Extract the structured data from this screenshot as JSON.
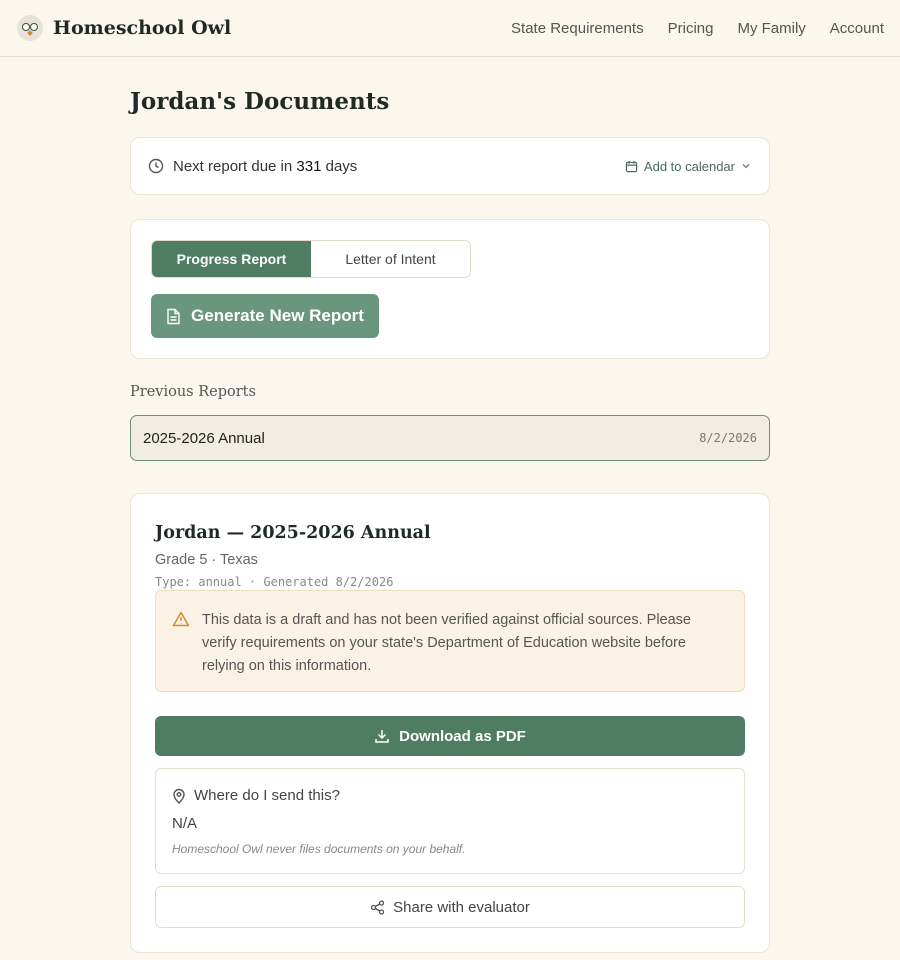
{
  "brand": {
    "name": "Homeschool Owl"
  },
  "nav": [
    "State Requirements",
    "Pricing",
    "My Family",
    "Account"
  ],
  "page": {
    "title": "Jordan's Documents"
  },
  "due": {
    "prefix": "Next report due in",
    "days": "331",
    "suffix": "days",
    "calendar_label": "Add to calendar"
  },
  "generate": {
    "tabs": [
      "Progress Report",
      "Letter of Intent"
    ],
    "active_tab": "Progress Report",
    "button_label": "Generate New Report"
  },
  "previous": {
    "label": "Previous Reports",
    "items": [
      {
        "name": "2025-2026 Annual",
        "date": "8/2/2026"
      }
    ]
  },
  "document": {
    "title": "Jordan — 2025-2026 Annual",
    "subtitle": "Grade 5 · Texas",
    "meta": "Type: annual · Generated 8/2/2026",
    "warning": "This data is a draft and has not been verified against official sources. Please verify requirements on your state's Department of Education website before relying on this information.",
    "download_label": "Download as PDF",
    "send_heading": "Where do I send this?",
    "send_value": "N/A",
    "send_note": "Homeschool Owl never files documents on your behalf.",
    "share_label": "Share with evaluator"
  },
  "colors": {
    "background": "#fbf6ee",
    "primary_green": "#4f7d64",
    "light_green": "#6a9680",
    "warning_bg": "#fbf2e6",
    "warning_icon": "#d9892b"
  }
}
